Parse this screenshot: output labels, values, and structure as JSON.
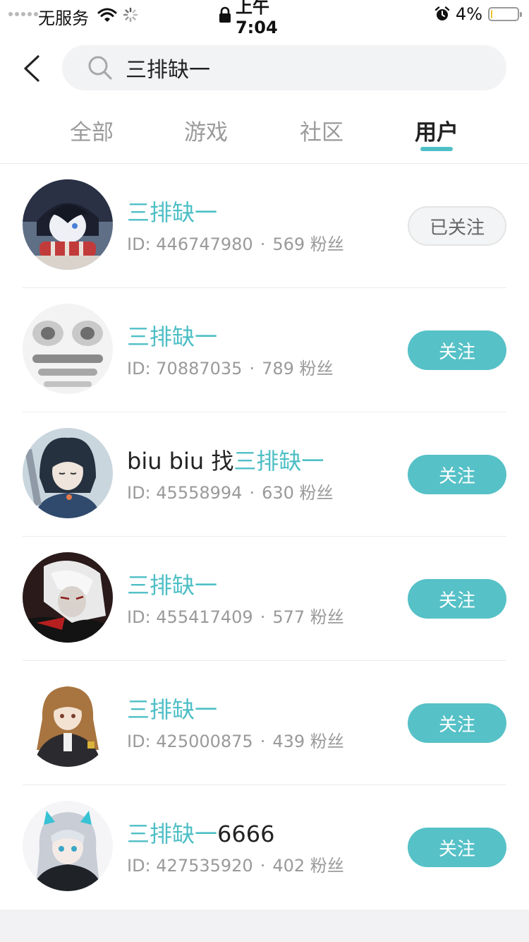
{
  "status_bar": {
    "carrier": "无服务",
    "time": "上午 7:04",
    "battery_pct": "4%",
    "battery_level": 0.04,
    "icons": [
      "signal-dots-icon",
      "wifi-icon",
      "loading-icon",
      "lock-icon",
      "alarm-icon",
      "battery-icon"
    ]
  },
  "search": {
    "query": "三排缺一",
    "back_icon": "chevron-left-icon",
    "search_icon": "magnifier-icon"
  },
  "tabs": [
    {
      "label": "全部",
      "active": false
    },
    {
      "label": "游戏",
      "active": false
    },
    {
      "label": "社区",
      "active": false
    },
    {
      "label": "用户",
      "active": true
    }
  ],
  "colors": {
    "accent": "#56c1c7",
    "highlight_text": "#4fbfc6",
    "followed_bg": "#f3f4f5"
  },
  "users": [
    {
      "name_prefix": "",
      "name_highlight": "三排缺一",
      "name_suffix": "",
      "id_text": "ID: 446747980",
      "separator": "·",
      "fans_text": "569 粉丝",
      "button_label": "已关注",
      "followed": true
    },
    {
      "name_prefix": "",
      "name_highlight": "三排缺一",
      "name_suffix": "",
      "id_text": "ID: 70887035",
      "separator": "·",
      "fans_text": "789 粉丝",
      "button_label": "关注",
      "followed": false
    },
    {
      "name_prefix": "biu biu 找",
      "name_highlight": "三排缺一",
      "name_suffix": "",
      "id_text": "ID: 45558994",
      "separator": "·",
      "fans_text": "630 粉丝",
      "button_label": "关注",
      "followed": false
    },
    {
      "name_prefix": "",
      "name_highlight": "三排缺一",
      "name_suffix": "",
      "id_text": "ID: 455417409",
      "separator": "·",
      "fans_text": "577 粉丝",
      "button_label": "关注",
      "followed": false
    },
    {
      "name_prefix": "",
      "name_highlight": "三排缺一",
      "name_suffix": "",
      "id_text": "ID: 425000875",
      "separator": "·",
      "fans_text": "439 粉丝",
      "button_label": "关注",
      "followed": false
    },
    {
      "name_prefix": "",
      "name_highlight": "三排缺一",
      "name_suffix": "6666",
      "id_text": "ID: 427535920",
      "separator": "·",
      "fans_text": "402 粉丝",
      "button_label": "关注",
      "followed": false
    }
  ]
}
